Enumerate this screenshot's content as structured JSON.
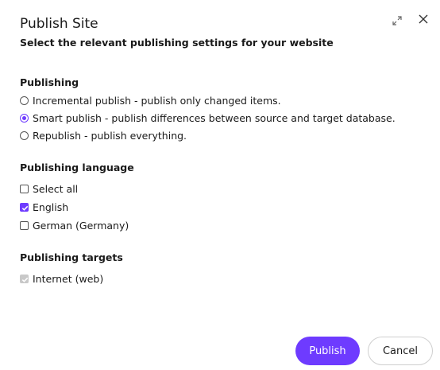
{
  "dialog": {
    "title": "Publish Site",
    "subtitle": "Select the relevant publishing settings for your website"
  },
  "publishing": {
    "heading": "Publishing",
    "options": [
      {
        "label": "Incremental publish - publish only changed items.",
        "selected": false
      },
      {
        "label": "Smart publish - publish differences between source and target database.",
        "selected": true
      },
      {
        "label": "Republish - publish everything.",
        "selected": false
      }
    ]
  },
  "language": {
    "heading": "Publishing language",
    "options": [
      {
        "label": "Select all",
        "checked": false
      },
      {
        "label": "English",
        "checked": true
      },
      {
        "label": "German (Germany)",
        "checked": false
      }
    ]
  },
  "targets": {
    "heading": "Publishing targets",
    "options": [
      {
        "label": "Internet (web)",
        "checked": true,
        "disabled": true
      }
    ]
  },
  "actions": {
    "publish_label": "Publish",
    "cancel_label": "Cancel"
  },
  "colors": {
    "accent": "#6e3bff",
    "disabled": "#c8c8c8"
  },
  "icons": {
    "expand": "expand-icon",
    "close": "close-icon"
  }
}
